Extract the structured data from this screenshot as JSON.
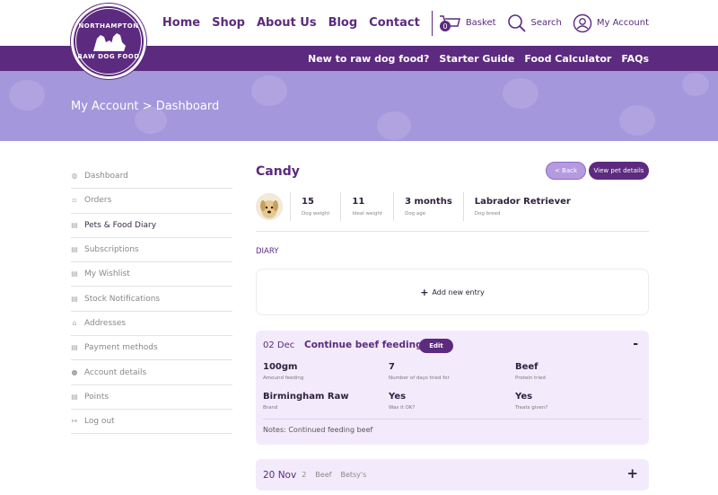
{
  "logo": {
    "top": "NORTHAMPTON",
    "bottom": "RAW DOG FOOD"
  },
  "nav": {
    "items": [
      "Home",
      "Shop",
      "About Us",
      "Blog",
      "Contact"
    ]
  },
  "utility": {
    "basket_label": "Basket",
    "basket_count": "0",
    "search_label": "Search",
    "account_label": "My Account"
  },
  "subnav": {
    "items": [
      "New to raw dog food?",
      "Starter Guide",
      "Food Calculator",
      "FAQs"
    ]
  },
  "hero": {
    "breadcrumb": "My Account > Dashboard"
  },
  "sidebar": {
    "items": [
      {
        "label": "Dashboard",
        "icon": "dashboard-icon"
      },
      {
        "label": "Orders",
        "icon": "orders-icon"
      },
      {
        "label": "Pets & Food Diary",
        "icon": "diary-icon"
      },
      {
        "label": "Subscriptions",
        "icon": "subscriptions-icon"
      },
      {
        "label": "My Wishlist",
        "icon": "wishlist-icon"
      },
      {
        "label": "Stock Notifications",
        "icon": "notifications-icon"
      },
      {
        "label": "Addresses",
        "icon": "home-icon"
      },
      {
        "label": "Payment methods",
        "icon": "payment-icon"
      },
      {
        "label": "Account details",
        "icon": "user-icon"
      },
      {
        "label": "Points",
        "icon": "points-icon"
      },
      {
        "label": "Log out",
        "icon": "logout-icon"
      }
    ]
  },
  "pet": {
    "name": "Candy",
    "back_label": "< Back",
    "view_label": "View pet details",
    "stats": [
      {
        "value": "15",
        "label": "Dog weight"
      },
      {
        "value": "11",
        "label": "Ideal weight"
      },
      {
        "value": "3 months",
        "label": "Dog age"
      },
      {
        "value": "Labrador Retriever",
        "label": "Dog breed"
      }
    ]
  },
  "diary": {
    "title": "DIARY",
    "add_label": "Add new entry",
    "entry1": {
      "date": "02 Dec",
      "title": "Continue beef feeding",
      "edit_label": "Edit",
      "toggle": "-",
      "fields": [
        {
          "value": "100gm",
          "label": "Amound feeding"
        },
        {
          "value": "7",
          "label": "Number of days tried for"
        },
        {
          "value": "Beef",
          "label": "Protein tried"
        },
        {
          "value": "Birmingham Raw",
          "label": "Brand"
        },
        {
          "value": "Yes",
          "label": "Was it OK?"
        },
        {
          "value": "Yes",
          "label": "Treats given?"
        }
      ],
      "notes": "Notes: Continued feeding beef"
    },
    "entry2": {
      "date": "20 Nov",
      "days": "2",
      "protein": "Beef",
      "brand": "Betsy's",
      "toggle": "+"
    }
  },
  "colors": {
    "brand": "#5c2a7e",
    "hero": "#a597dc",
    "entry_bg": "#f3ebfc"
  }
}
